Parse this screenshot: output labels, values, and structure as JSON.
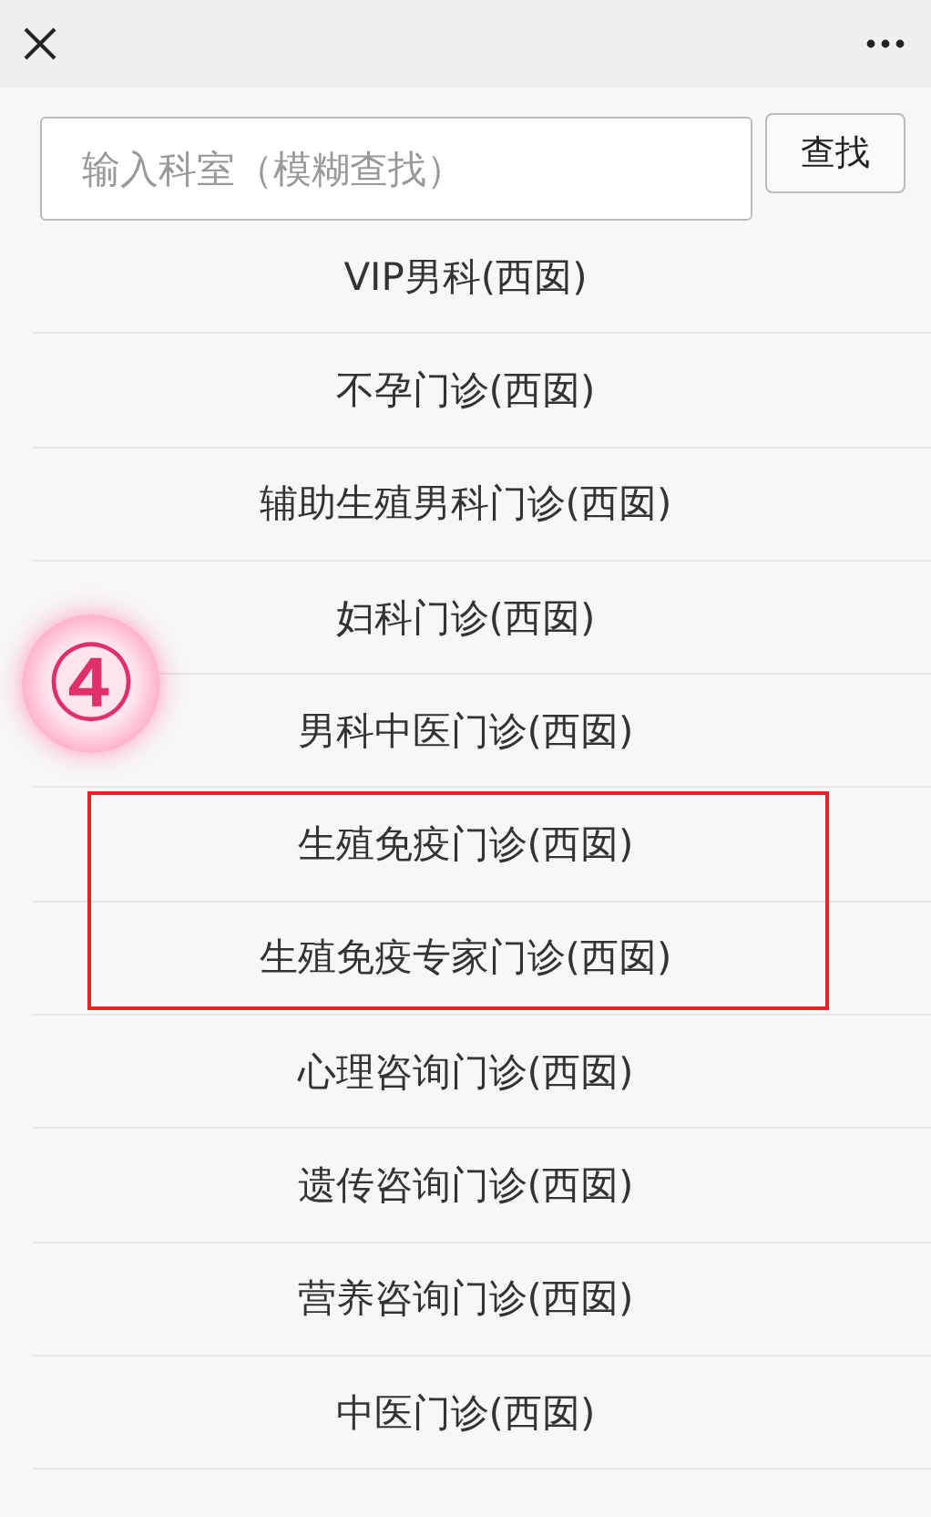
{
  "search": {
    "placeholder": "输入科室（模糊查找）",
    "button": "查找"
  },
  "departments": [
    {
      "name": "VIP男科(西囡)",
      "highlighted": false
    },
    {
      "name": "不孕门诊(西囡)",
      "highlighted": false
    },
    {
      "name": "辅助生殖男科门诊(西囡)",
      "highlighted": false
    },
    {
      "name": "妇科门诊(西囡)",
      "highlighted": false
    },
    {
      "name": "男科中医门诊(西囡)",
      "highlighted": false
    },
    {
      "name": "生殖免疫门诊(西囡)",
      "highlighted": true
    },
    {
      "name": "生殖免疫专家门诊(西囡)",
      "highlighted": true
    },
    {
      "name": "心理咨询门诊(西囡)",
      "highlighted": false
    },
    {
      "name": "遗传咨询门诊(西囡)",
      "highlighted": false
    },
    {
      "name": "营养咨询门诊(西囡)",
      "highlighted": false
    },
    {
      "name": "中医门诊(西囡)",
      "highlighted": false
    }
  ],
  "annotation": {
    "label": "④"
  }
}
